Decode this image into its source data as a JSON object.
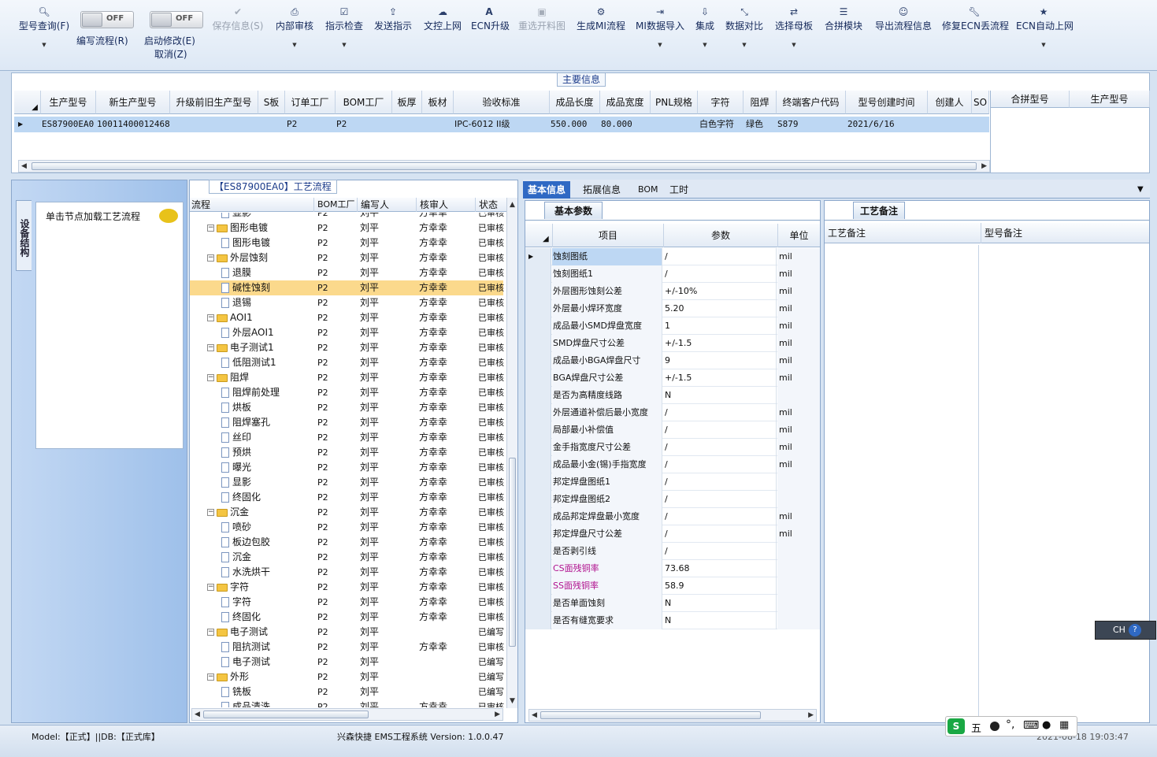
{
  "toolbar": {
    "items": [
      {
        "label": "型号查询(F)",
        "icon": "search-icon"
      },
      {
        "label": "编写流程(R)",
        "icon": "toggle-off"
      },
      {
        "label": "启动修改(E)",
        "icon": "toggle-off"
      },
      {
        "label": "保存信息(S)",
        "icon": "check-icon"
      },
      {
        "label": "内部审核",
        "icon": "print-icon"
      },
      {
        "label": "指示检查",
        "icon": "checkbox-icon"
      },
      {
        "label": "发送指示",
        "icon": "upload-icon"
      },
      {
        "label": "文控上网",
        "icon": "cloud-icon"
      },
      {
        "label": "ECN升级",
        "icon": "font-a-icon"
      },
      {
        "label": "重选开料图",
        "icon": "image-icon"
      },
      {
        "label": "生成MI流程",
        "icon": "gears-icon"
      },
      {
        "label": "MI数据导入",
        "icon": "import-icon"
      },
      {
        "label": "集成",
        "icon": "download-icon"
      },
      {
        "label": "数据对比",
        "icon": "compress-icon"
      },
      {
        "label": "选择母板",
        "icon": "shuffle-icon"
      },
      {
        "label": "合拼模块",
        "icon": "list-icon"
      },
      {
        "label": "导出流程信息",
        "icon": "smile-icon"
      },
      {
        "label": "修复ECN丢流程",
        "icon": "wrench-icon"
      },
      {
        "label": "ECN自动上网",
        "icon": "star-icon"
      }
    ],
    "toggle_off_text": "OFF",
    "cancel_label": "取消(Z)"
  },
  "main_info": {
    "title": "主要信息",
    "columns": [
      "生产型号",
      "新生产型号",
      "升级前旧生产型号",
      "S板",
      "订单工厂",
      "BOM工厂",
      "板厚",
      "板材",
      "验收标准",
      "成品长度",
      "成品宽度",
      "PNL规格",
      "字符",
      "阻焊",
      "终端客户代码",
      "型号创建时间",
      "创建人",
      "SO"
    ],
    "row": [
      "ES87900EA0",
      "10011400012468",
      "",
      "",
      "P2",
      "P2",
      "",
      "",
      "IPC-6012 II级",
      "550.000",
      "80.000",
      "",
      "白色字符",
      "绿色",
      "S879",
      "2021/6/16",
      "",
      ""
    ],
    "merge_columns": [
      "合拼型号",
      "生产型号"
    ]
  },
  "left_nav": {
    "vertical_tab": "设备结构",
    "node_hint": "单击节点加载工艺流程"
  },
  "tree": {
    "title": "【ES87900EA0】工艺流程",
    "columns": [
      "流程",
      "BOM工厂",
      "编写人",
      "核审人",
      "状态"
    ],
    "rows": [
      {
        "name": "显影",
        "level": 2,
        "type": "doc",
        "bom": "P2",
        "writer": "刘平",
        "reviewer": "方幸幸",
        "status": "已审核"
      },
      {
        "name": "图形电镀",
        "level": 1,
        "type": "folder",
        "bom": "P2",
        "writer": "刘平",
        "reviewer": "方幸幸",
        "status": "已审核"
      },
      {
        "name": "图形电镀",
        "level": 2,
        "type": "doc",
        "bom": "P2",
        "writer": "刘平",
        "reviewer": "方幸幸",
        "status": "已审核"
      },
      {
        "name": "外层蚀刻",
        "level": 1,
        "type": "folder",
        "bom": "P2",
        "writer": "刘平",
        "reviewer": "方幸幸",
        "status": "已审核"
      },
      {
        "name": "退膜",
        "level": 2,
        "type": "doc",
        "bom": "P2",
        "writer": "刘平",
        "reviewer": "方幸幸",
        "status": "已审核"
      },
      {
        "name": "碱性蚀刻",
        "level": 2,
        "type": "doc",
        "bom": "P2",
        "writer": "刘平",
        "reviewer": "方幸幸",
        "status": "已审核",
        "selected": true
      },
      {
        "name": "退锡",
        "level": 2,
        "type": "doc",
        "bom": "P2",
        "writer": "刘平",
        "reviewer": "方幸幸",
        "status": "已审核"
      },
      {
        "name": "AOI1",
        "level": 1,
        "type": "folder",
        "bom": "P2",
        "writer": "刘平",
        "reviewer": "方幸幸",
        "status": "已审核"
      },
      {
        "name": "外层AOI1",
        "level": 2,
        "type": "doc",
        "bom": "P2",
        "writer": "刘平",
        "reviewer": "方幸幸",
        "status": "已审核"
      },
      {
        "name": "电子测试1",
        "level": 1,
        "type": "folder",
        "bom": "P2",
        "writer": "刘平",
        "reviewer": "方幸幸",
        "status": "已审核"
      },
      {
        "name": "低阻测试1",
        "level": 2,
        "type": "doc",
        "bom": "P2",
        "writer": "刘平",
        "reviewer": "方幸幸",
        "status": "已审核"
      },
      {
        "name": "阻焊",
        "level": 1,
        "type": "folder",
        "bom": "P2",
        "writer": "刘平",
        "reviewer": "方幸幸",
        "status": "已审核"
      },
      {
        "name": "阻焊前处理",
        "level": 2,
        "type": "doc",
        "bom": "P2",
        "writer": "刘平",
        "reviewer": "方幸幸",
        "status": "已审核"
      },
      {
        "name": "烘板",
        "level": 2,
        "type": "doc",
        "bom": "P2",
        "writer": "刘平",
        "reviewer": "方幸幸",
        "status": "已审核"
      },
      {
        "name": "阻焊塞孔",
        "level": 2,
        "type": "doc",
        "bom": "P2",
        "writer": "刘平",
        "reviewer": "方幸幸",
        "status": "已审核"
      },
      {
        "name": "丝印",
        "level": 2,
        "type": "doc",
        "bom": "P2",
        "writer": "刘平",
        "reviewer": "方幸幸",
        "status": "已审核"
      },
      {
        "name": "预烘",
        "level": 2,
        "type": "doc",
        "bom": "P2",
        "writer": "刘平",
        "reviewer": "方幸幸",
        "status": "已审核"
      },
      {
        "name": "曝光",
        "level": 2,
        "type": "doc",
        "bom": "P2",
        "writer": "刘平",
        "reviewer": "方幸幸",
        "status": "已审核"
      },
      {
        "name": "显影",
        "level": 2,
        "type": "doc",
        "bom": "P2",
        "writer": "刘平",
        "reviewer": "方幸幸",
        "status": "已审核"
      },
      {
        "name": "终固化",
        "level": 2,
        "type": "doc",
        "bom": "P2",
        "writer": "刘平",
        "reviewer": "方幸幸",
        "status": "已审核"
      },
      {
        "name": "沉金",
        "level": 1,
        "type": "folder",
        "bom": "P2",
        "writer": "刘平",
        "reviewer": "方幸幸",
        "status": "已审核"
      },
      {
        "name": "喷砂",
        "level": 2,
        "type": "doc",
        "bom": "P2",
        "writer": "刘平",
        "reviewer": "方幸幸",
        "status": "已审核"
      },
      {
        "name": "板边包胶",
        "level": 2,
        "type": "doc",
        "bom": "P2",
        "writer": "刘平",
        "reviewer": "方幸幸",
        "status": "已审核"
      },
      {
        "name": "沉金",
        "level": 2,
        "type": "doc",
        "bom": "P2",
        "writer": "刘平",
        "reviewer": "方幸幸",
        "status": "已审核"
      },
      {
        "name": "水洗烘干",
        "level": 2,
        "type": "doc",
        "bom": "P2",
        "writer": "刘平",
        "reviewer": "方幸幸",
        "status": "已审核"
      },
      {
        "name": "字符",
        "level": 1,
        "type": "folder",
        "bom": "P2",
        "writer": "刘平",
        "reviewer": "方幸幸",
        "status": "已审核"
      },
      {
        "name": "字符",
        "level": 2,
        "type": "doc",
        "bom": "P2",
        "writer": "刘平",
        "reviewer": "方幸幸",
        "status": "已审核"
      },
      {
        "name": "终固化",
        "level": 2,
        "type": "doc",
        "bom": "P2",
        "writer": "刘平",
        "reviewer": "方幸幸",
        "status": "已审核"
      },
      {
        "name": "电子测试",
        "level": 1,
        "type": "folder",
        "bom": "P2",
        "writer": "刘平",
        "reviewer": "",
        "status": "已编写"
      },
      {
        "name": "阻抗测试",
        "level": 2,
        "type": "doc",
        "bom": "P2",
        "writer": "刘平",
        "reviewer": "方幸幸",
        "status": "已审核"
      },
      {
        "name": "电子测试",
        "level": 2,
        "type": "doc",
        "bom": "P2",
        "writer": "刘平",
        "reviewer": "",
        "status": "已编写"
      },
      {
        "name": "外形",
        "level": 1,
        "type": "folder",
        "bom": "P2",
        "writer": "刘平",
        "reviewer": "",
        "status": "已编写"
      },
      {
        "name": "铣板",
        "level": 2,
        "type": "doc",
        "bom": "P2",
        "writer": "刘平",
        "reviewer": "",
        "status": "已编写"
      },
      {
        "name": "成品清洗",
        "level": 2,
        "type": "doc",
        "bom": "P2",
        "writer": "刘平",
        "reviewer": "方幸幸",
        "status": "已审核"
      }
    ]
  },
  "right_tabs": [
    "基本信息",
    "拓展信息",
    "BOM",
    "工时"
  ],
  "params": {
    "panel_tab": "基本参数",
    "columns": [
      "项目",
      "参数",
      "单位"
    ],
    "rows": [
      {
        "item": "蚀刻图纸",
        "value": "/",
        "unit": "mil"
      },
      {
        "item": "蚀刻图纸1",
        "value": "/",
        "unit": "mil"
      },
      {
        "item": "外层图形蚀刻公差",
        "value": "+/-10%",
        "unit": "mil"
      },
      {
        "item": "外层最小焊环宽度",
        "value": "5.20",
        "unit": "mil"
      },
      {
        "item": "成品最小SMD焊盘宽度",
        "value": "1",
        "unit": "mil"
      },
      {
        "item": "SMD焊盘尺寸公差",
        "value": "+/-1.5",
        "unit": "mil"
      },
      {
        "item": "成品最小BGA焊盘尺寸",
        "value": "9",
        "unit": "mil"
      },
      {
        "item": "BGA焊盘尺寸公差",
        "value": "+/-1.5",
        "unit": "mil"
      },
      {
        "item": "是否为高精度线路",
        "value": "N",
        "unit": ""
      },
      {
        "item": "外层通道补偿后最小宽度",
        "value": "/",
        "unit": "mil"
      },
      {
        "item": "局部最小补偿值",
        "value": "/",
        "unit": "mil"
      },
      {
        "item": "金手指宽度尺寸公差",
        "value": "/",
        "unit": "mil"
      },
      {
        "item": "成品最小金(锡)手指宽度",
        "value": "/",
        "unit": "mil"
      },
      {
        "item": "邦定焊盘图纸1",
        "value": "/",
        "unit": ""
      },
      {
        "item": "邦定焊盘图纸2",
        "value": "/",
        "unit": ""
      },
      {
        "item": "成品邦定焊盘最小宽度",
        "value": "/",
        "unit": "mil"
      },
      {
        "item": "邦定焊盘尺寸公差",
        "value": "/",
        "unit": "mil"
      },
      {
        "item": "是否剥引线",
        "value": "/",
        "unit": ""
      },
      {
        "item": "CS面残铜率",
        "value": "73.68",
        "unit": "",
        "highlight": true
      },
      {
        "item": "SS面残铜率",
        "value": "58.9",
        "unit": "",
        "highlight": true
      },
      {
        "item": "是否单面蚀刻",
        "value": "N",
        "unit": ""
      },
      {
        "item": "是否有缝宽要求",
        "value": "N",
        "unit": ""
      }
    ],
    "highlight_color": "#b0108e"
  },
  "notes": {
    "panel_tab": "工艺备注",
    "columns": [
      "工艺备注",
      "型号备注"
    ]
  },
  "status": {
    "left": "Model:【正式】||DB:【正式库】",
    "center": "兴森快捷 EMS工程系统 Version: 1.0.0.47",
    "clock": "2021-08-18 19:03:47"
  },
  "ime": {
    "lang": "CH",
    "mode": "五"
  }
}
